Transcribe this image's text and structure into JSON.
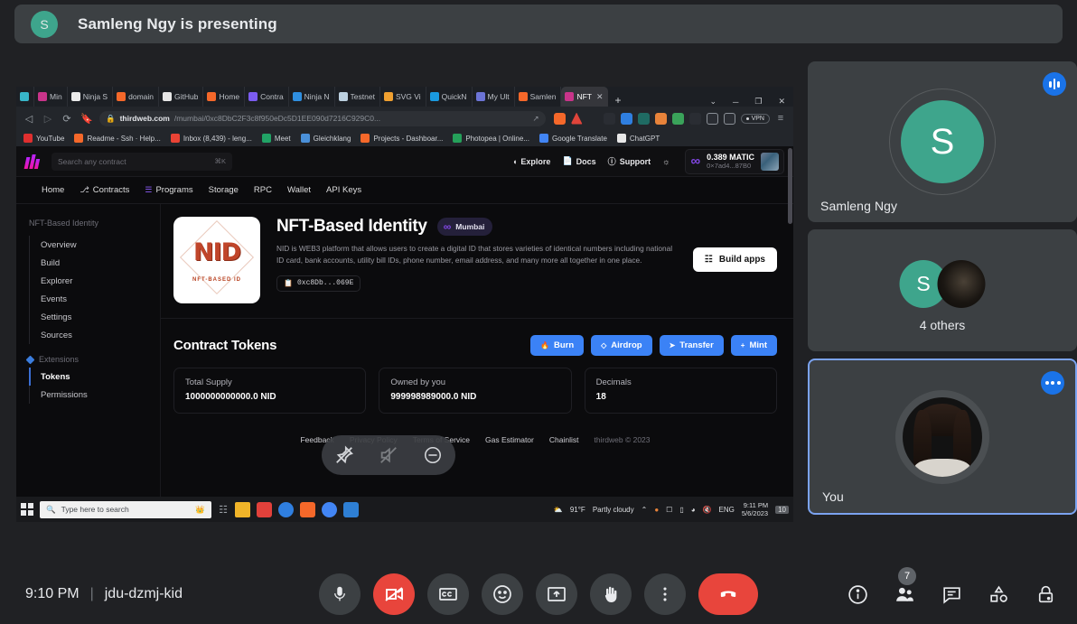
{
  "banner": {
    "avatar_letter": "S",
    "text": "Samleng Ngy is presenting"
  },
  "browser": {
    "tabs": [
      {
        "label": "",
        "color": "#38b6c9",
        "active": false
      },
      {
        "label": "Min",
        "color": "#c9348a",
        "active": false
      },
      {
        "label": "Ninja S",
        "color": "#eaeaea",
        "active": false
      },
      {
        "label": "domain",
        "color": "#f5682a",
        "active": false
      },
      {
        "label": "GitHub",
        "color": "#e6e6e6",
        "active": false
      },
      {
        "label": "Home",
        "color": "#f5682a",
        "active": false
      },
      {
        "label": "Contra",
        "color": "#7b5cf0",
        "active": false
      },
      {
        "label": "Ninja N",
        "color": "#2f8fe0",
        "active": false
      },
      {
        "label": "Testnet",
        "color": "#bcd0e0",
        "active": false
      },
      {
        "label": "SVG Vi",
        "color": "#f0a030",
        "active": false
      },
      {
        "label": "QuickN",
        "color": "#1a9ae0",
        "active": false
      },
      {
        "label": "My Ult",
        "color": "#6c74d6",
        "active": false
      },
      {
        "label": "Samlen",
        "color": "#f5682a",
        "active": false
      },
      {
        "label": "NFT",
        "color": "#c9348a",
        "active": true
      }
    ],
    "new_tab": "+",
    "window_controls": [
      "⌄",
      "─",
      "❐",
      "✕"
    ],
    "url_host": "thirdweb.com",
    "url_path": "/mumbai/0xc8DbC2F3c8f950eDc5D1EE090d7216C929C0...",
    "vpn_label": "VPN",
    "bookmarks": [
      {
        "label": "YouTube",
        "color": "#e02f2f"
      },
      {
        "label": "Readme - Ssh · Help...",
        "color": "#f5682a"
      },
      {
        "label": "Inbox (8,439) - leng...",
        "color": "#ea4335"
      },
      {
        "label": "Meet",
        "color": "#21a366"
      },
      {
        "label": "Gleichklang",
        "color": "#4a90d9"
      },
      {
        "label": "Projects - Dashboar...",
        "color": "#f5682a"
      },
      {
        "label": "Photopea | Online...",
        "color": "#25a05a"
      },
      {
        "label": "Google Translate",
        "color": "#4285f4"
      },
      {
        "label": "ChatGPT",
        "color": "#e8e8e8"
      }
    ]
  },
  "thirdweb": {
    "search_placeholder": "Search any contract",
    "search_shortcut": "⌘K",
    "nav_right": [
      "Explore",
      "Docs",
      "Support"
    ],
    "wallet_amount": "0.389 MATIC",
    "wallet_address": "0×7ad4...87B0",
    "tabs": [
      "Home",
      "Contracts",
      "Programs",
      "Storage",
      "RPC",
      "Wallet",
      "API Keys"
    ],
    "sidebar_title": "NFT-Based Identity",
    "sidebar_items": [
      "Overview",
      "Build",
      "Explorer",
      "Events",
      "Settings",
      "Sources"
    ],
    "sidebar_group": "Extensions",
    "sidebar_group_items": [
      "Tokens",
      "Permissions"
    ],
    "sidebar_selected": "Tokens",
    "logo_text": "NID",
    "logo_sub": "NFT-BASED ID",
    "hero_title": "NFT-Based Identity",
    "chain": "Mumbai",
    "description": "NID is WEB3 platform that allows users to create a digital ID that stores varieties of identical numbers including national ID card, bank accounts, utility bill IDs, phone number, email address, and many more all together in one place.",
    "contract_address": "0xc8Db...069E",
    "build_button": "Build apps",
    "tokens_heading": "Contract Tokens",
    "token_actions": [
      "Burn",
      "Airdrop",
      "Transfer",
      "Mint"
    ],
    "stats": [
      {
        "label": "Total Supply",
        "value": "1000000000000.0 NID"
      },
      {
        "label": "Owned by you",
        "value": "999998989000.0 NID"
      },
      {
        "label": "Decimals",
        "value": "18"
      }
    ],
    "footer_links": [
      "Feedback",
      "Privacy Policy",
      "Terms of Service",
      "Gas Estimator",
      "Chainlist"
    ],
    "footer_copyright": "thirdweb © 2023"
  },
  "taskbar": {
    "search_placeholder": "Type here to search",
    "weather_temp": "91°F",
    "weather_desc": "Partly cloudy",
    "language": "ENG",
    "time": "9:11 PM",
    "date": "5/6/2023",
    "notification_count": "10"
  },
  "rail": {
    "tiles": [
      {
        "name": "Samleng Ngy",
        "avatar_letter": "S",
        "badge": "audio-waveform"
      },
      {
        "name": "4 others",
        "avatar_letter": "S",
        "badge": ""
      },
      {
        "name": "You",
        "avatar_letter": "",
        "badge": "more-options"
      }
    ]
  },
  "controls": {
    "time": "9:10 PM",
    "separator": "|",
    "meeting_code": "jdu-dzmj-kid",
    "buttons": [
      {
        "name": "microphone",
        "state": "on"
      },
      {
        "name": "camera",
        "state": "off"
      },
      {
        "name": "captions",
        "state": "on"
      },
      {
        "name": "reactions",
        "state": "on"
      },
      {
        "name": "present",
        "state": "on"
      },
      {
        "name": "raise-hand",
        "state": "on"
      },
      {
        "name": "more-options",
        "state": "on"
      },
      {
        "name": "leave-call",
        "state": "red"
      }
    ],
    "right_buttons": [
      "meeting-details",
      "people",
      "chat",
      "activities",
      "host-controls"
    ],
    "people_count": "7"
  }
}
